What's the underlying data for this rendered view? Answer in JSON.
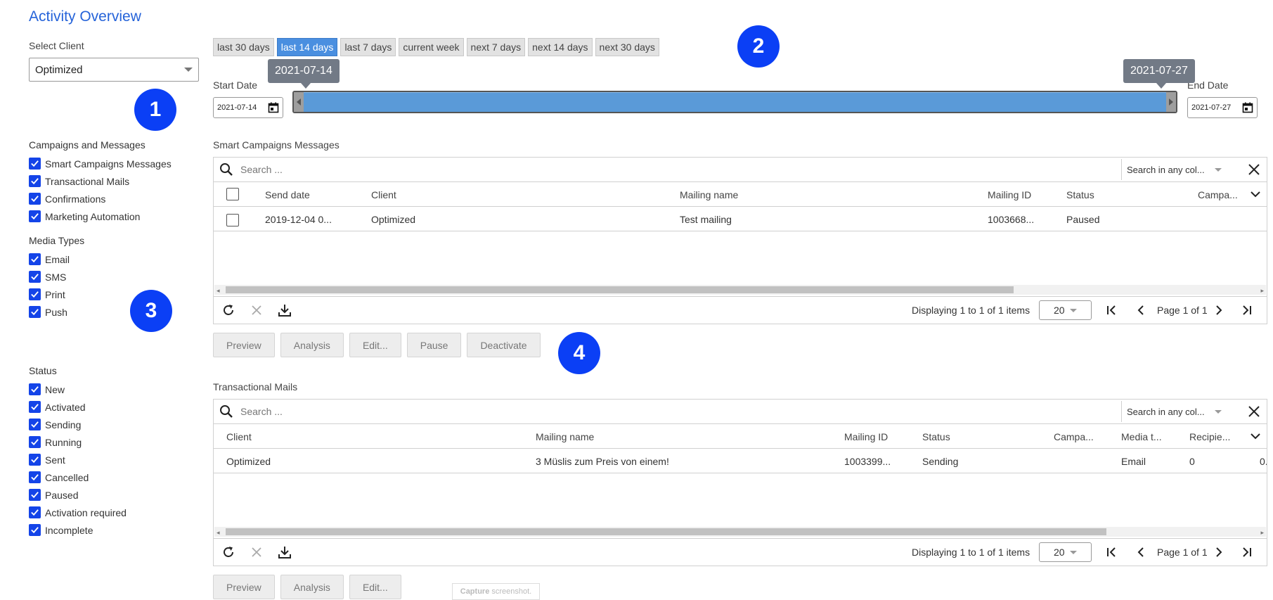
{
  "page": {
    "title": "Activity Overview"
  },
  "sidebar": {
    "select_client_label": "Select Client",
    "select_client_value": "Optimized",
    "campaigns_title": "Campaigns and Messages",
    "campaigns": [
      "Smart Campaigns Messages",
      "Transactional Mails",
      "Confirmations",
      "Marketing Automation"
    ],
    "media_title": "Media Types",
    "media": [
      "Email",
      "SMS",
      "Print",
      "Push"
    ],
    "status_title": "Status",
    "statuses": [
      "New",
      "Activated",
      "Sending",
      "Running",
      "Sent",
      "Cancelled",
      "Paused",
      "Activation required",
      "Incomplete"
    ]
  },
  "badges": [
    "1",
    "2",
    "3",
    "4"
  ],
  "range_buttons": [
    "last 30 days",
    "last 14 days",
    "last 7 days",
    "current week",
    "next 7 days",
    "next 14 days",
    "next 30 days"
  ],
  "active_range": "last 14 days",
  "dates": {
    "start_label": "Start Date",
    "end_label": "End Date",
    "start_value": "2021-07-14",
    "end_value": "2021-07-27",
    "start_tip": "2021-07-14",
    "end_tip": "2021-07-27"
  },
  "smart": {
    "title": "Smart Campaigns Messages",
    "search_placeholder": "Search ...",
    "search_scope": "Search in any col...",
    "columns": [
      "Send date",
      "Client",
      "Mailing name",
      "Mailing ID",
      "Status",
      "Campa..."
    ],
    "row": {
      "send_date": "2019-12-04 0...",
      "client": "Optimized",
      "mailing_name": "Test mailing",
      "mailing_id": "1003668...",
      "status": "Paused"
    },
    "displaying": "Displaying 1 to 1 of 1 items",
    "page_size": "20",
    "page": "Page 1 of 1",
    "actions": [
      "Preview",
      "Analysis",
      "Edit...",
      "Pause",
      "Deactivate"
    ]
  },
  "trans": {
    "title": "Transactional Mails",
    "search_placeholder": "Search ...",
    "search_scope": "Search in any col...",
    "columns": [
      "Client",
      "Mailing name",
      "Mailing ID",
      "Status",
      "Campa...",
      "Media t...",
      "Recipie..."
    ],
    "row": {
      "client": "Optimized",
      "mailing_name": "3 Müslis zum Preis von einem!",
      "mailing_id": "1003399...",
      "status": "Sending",
      "media": "Email",
      "recipients": "0",
      "extra": "0."
    },
    "displaying": "Displaying 1 to 1 of 1 items",
    "page_size": "20",
    "page": "Page 1 of 1",
    "actions": [
      "Preview",
      "Analysis",
      "Edit..."
    ]
  },
  "capture": {
    "bold": "Capture",
    "rest": " screenshot."
  },
  "colors": {
    "accent": "#2563d9",
    "badge": "#0b3ff5",
    "checkbox": "#1444e8",
    "active_range": "#4a8fe0",
    "slider": "#5a9ad8"
  }
}
